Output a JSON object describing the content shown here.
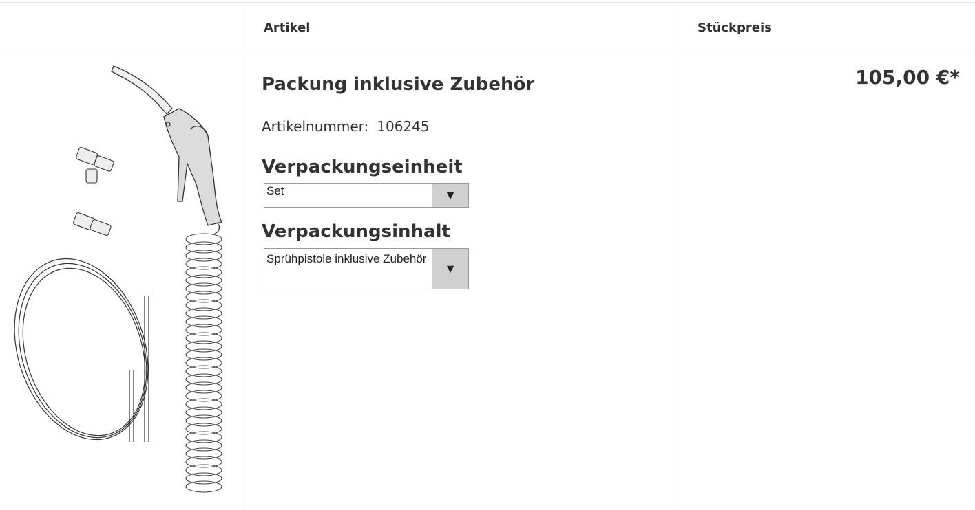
{
  "header": {
    "col_image": "",
    "col_article": "Artikel",
    "col_price": "Stückpreis"
  },
  "product": {
    "image_icon": "spray-gun-kit-image",
    "title": "Packung inklusive Zubehör",
    "article_number_label": "Artikelnummer:",
    "article_number": "106245",
    "packaging_unit_heading": "Verpackungseinheit",
    "packaging_unit_value": "Set",
    "packaging_content_heading": "Verpackungsinhalt",
    "packaging_content_value": "Sprühpistole inklusive Zubehör",
    "price": "105,00 €*"
  },
  "icons": {
    "dropdown_arrow": "▼"
  }
}
